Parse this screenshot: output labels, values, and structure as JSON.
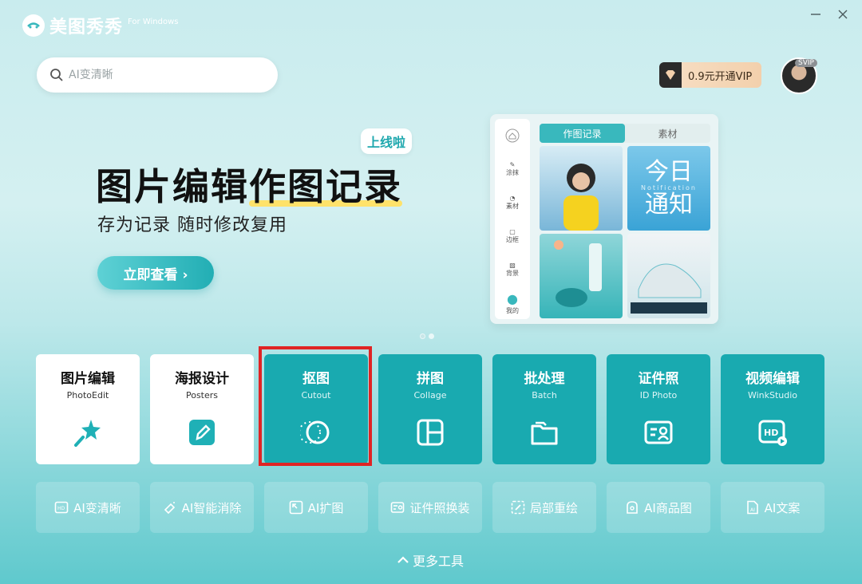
{
  "app": {
    "name": "美图秀秀",
    "subtitle": "For Windows"
  },
  "search": {
    "placeholder": "AI变清晰"
  },
  "vip": {
    "label": "0.9元开通VIP"
  },
  "avatar": {
    "badge": "SVIP"
  },
  "banner": {
    "badge": "上线啦",
    "title_part1": "图片编辑",
    "title_part2": "作图记录",
    "subtitle": "存为记录 随时修改复用",
    "button": "立即查看 ›",
    "mock": {
      "tabs": [
        "作图记录",
        "素材"
      ],
      "side_items": [
        "涂抹",
        "素材",
        "边框",
        "背景",
        "我的"
      ],
      "tile2_text1": "今日",
      "tile2_small": "Notification",
      "tile2_text2": "通知"
    },
    "pages": 2,
    "current_page": 1
  },
  "tools": [
    {
      "title": "图片编辑",
      "subtitle": "PhotoEdit",
      "icon": "magic-wand-icon",
      "style": "white"
    },
    {
      "title": "海报设计",
      "subtitle": "Posters",
      "icon": "pen-edit-icon",
      "style": "white"
    },
    {
      "title": "抠图",
      "subtitle": "Cutout",
      "icon": "cutout-circle-icon",
      "style": "teal"
    },
    {
      "title": "拼图",
      "subtitle": "Collage",
      "icon": "collage-grid-icon",
      "style": "teal"
    },
    {
      "title": "批处理",
      "subtitle": "Batch",
      "icon": "folder-stack-icon",
      "style": "teal"
    },
    {
      "title": "证件照",
      "subtitle": "ID Photo",
      "icon": "id-card-icon",
      "style": "teal"
    },
    {
      "title": "视频编辑",
      "subtitle": "WinkStudio",
      "icon": "hd-video-icon",
      "style": "teal"
    }
  ],
  "ai_tools": [
    {
      "label": "AI变清晰",
      "icon": "hd-icon"
    },
    {
      "label": "AI智能消除",
      "icon": "eraser-icon"
    },
    {
      "label": "AI扩图",
      "icon": "expand-icon"
    },
    {
      "label": "证件照换装",
      "icon": "id-swap-icon"
    },
    {
      "label": "局部重绘",
      "icon": "repaint-icon"
    },
    {
      "label": "AI商品图",
      "icon": "product-icon"
    },
    {
      "label": "AI文案",
      "icon": "doc-ai-icon"
    }
  ],
  "more_tools": "更多工具",
  "colors": {
    "accent": "#19aab0",
    "highlight_border": "#e02424"
  }
}
